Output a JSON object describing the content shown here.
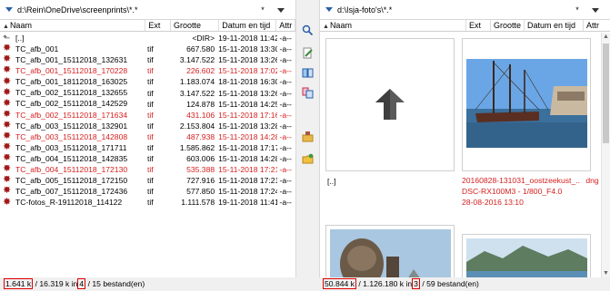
{
  "left": {
    "path": "d:\\Rein\\OneDrive\\screenprints\\*.*",
    "star": "*",
    "columns": {
      "name": "Naam",
      "ext": "Ext",
      "size": "Grootte",
      "date": "Datum en tijd",
      "attr": "Attr"
    },
    "rows": [
      {
        "name": "[..]",
        "ext": "",
        "size": "<DIR>",
        "date": "19-11-2018 11:42",
        "attr": "-a--",
        "red": false,
        "icon": "up-folder-icon"
      },
      {
        "name": "TC_afb_001",
        "ext": "tif",
        "size": "667.580",
        "date": "15-11-2018 13:30",
        "attr": "-a--",
        "red": false,
        "icon": "image-file-icon"
      },
      {
        "name": "TC_afb_001_15112018_132631",
        "ext": "tif",
        "size": "3.147.522",
        "date": "15-11-2018 13:26",
        "attr": "-a--",
        "red": false,
        "icon": "image-file-icon"
      },
      {
        "name": "TC_afb_001_15112018_170228",
        "ext": "tif",
        "size": "226.602",
        "date": "15-11-2018 17:02",
        "attr": "-a--",
        "red": true,
        "icon": "image-file-icon"
      },
      {
        "name": "TC_afb_001_18112018_163025",
        "ext": "tif",
        "size": "1.183.074",
        "date": "18-11-2018 16:30",
        "attr": "-a--",
        "red": false,
        "icon": "image-file-icon"
      },
      {
        "name": "TC_afb_002_15112018_132655",
        "ext": "tif",
        "size": "3.147.522",
        "date": "15-11-2018 13:26",
        "attr": "-a--",
        "red": false,
        "icon": "image-file-icon"
      },
      {
        "name": "TC_afb_002_15112018_142529",
        "ext": "tif",
        "size": "124.878",
        "date": "15-11-2018 14:25",
        "attr": "-a--",
        "red": false,
        "icon": "image-file-icon"
      },
      {
        "name": "TC_afb_002_15112018_171634",
        "ext": "tif",
        "size": "431.106",
        "date": "15-11-2018 17:16",
        "attr": "-a--",
        "red": true,
        "icon": "image-file-icon"
      },
      {
        "name": "TC_afb_003_15112018_132901",
        "ext": "tif",
        "size": "2.153.804",
        "date": "15-11-2018 13:28",
        "attr": "-a--",
        "red": false,
        "icon": "image-file-icon"
      },
      {
        "name": "TC_afb_003_15112018_142808",
        "ext": "tif",
        "size": "487.938",
        "date": "15-11-2018 14:28",
        "attr": "-a--",
        "red": true,
        "icon": "image-file-icon"
      },
      {
        "name": "TC_afb_003_15112018_171711",
        "ext": "tif",
        "size": "1.585.862",
        "date": "15-11-2018 17:17",
        "attr": "-a--",
        "red": false,
        "icon": "image-file-icon"
      },
      {
        "name": "TC_afb_004_15112018_142835",
        "ext": "tif",
        "size": "603.006",
        "date": "15-11-2018 14:28",
        "attr": "-a--",
        "red": false,
        "icon": "image-file-icon"
      },
      {
        "name": "TC_afb_004_15112018_172130",
        "ext": "tif",
        "size": "535.388",
        "date": "15-11-2018 17:21",
        "attr": "-a--",
        "red": true,
        "icon": "image-file-icon"
      },
      {
        "name": "TC_afb_005_15112018_172150",
        "ext": "tif",
        "size": "727.916",
        "date": "15-11-2018 17:21",
        "attr": "-a--",
        "red": false,
        "icon": "image-file-icon"
      },
      {
        "name": "TC_afb_007_15112018_172436",
        "ext": "tif",
        "size": "577.850",
        "date": "15-11-2018 17:24",
        "attr": "-a--",
        "red": false,
        "icon": "image-file-icon"
      },
      {
        "name": "TC-fotos_R-19112018_114122",
        "ext": "tif",
        "size": "1.111.578",
        "date": "19-11-2018 11:41",
        "attr": "-a--",
        "red": false,
        "icon": "image-file-icon"
      }
    ],
    "status": {
      "selected": "1.641 k",
      "sep": "/ 16.319 k in",
      "count": "4",
      "rest": "/ 15 bestand(en)"
    }
  },
  "right": {
    "path": "d:\\Isja-foto's\\*.*",
    "star": "*",
    "columns": {
      "name": "Naam",
      "ext": "Ext",
      "size": "Grootte",
      "date": "Datum en tijd",
      "attr": "Attr"
    },
    "tiles": [
      {
        "label": "[..]",
        "icon": "up-arrow-icon"
      },
      {
        "line1": "20160828-131031_oostzeekust_..",
        "ext": "dng",
        "line2": "DSC-RX100M3 - 1/800_F4.0",
        "line3": "28-08-2016 13:10",
        "icon": "photo-ship-harbor"
      },
      {
        "icon": "photo-sculpture-head"
      },
      {
        "icon": "photo-lake-mountains"
      }
    ],
    "status": {
      "selected": "50.844 k",
      "sep": "/ 1.126.180 k in",
      "count": "3",
      "rest": "/ 59 bestand(en)"
    }
  },
  "colors": {
    "accent": "#2a5ea8",
    "highlight": "#e00000",
    "red_file": "#d62020"
  },
  "buttons": [
    {
      "name": "search-icon"
    },
    {
      "name": "edit-icon"
    },
    {
      "name": "compare-icon"
    },
    {
      "name": "sync-icon"
    },
    {
      "name": "pack-icon"
    },
    {
      "name": "new-folder-icon"
    }
  ]
}
